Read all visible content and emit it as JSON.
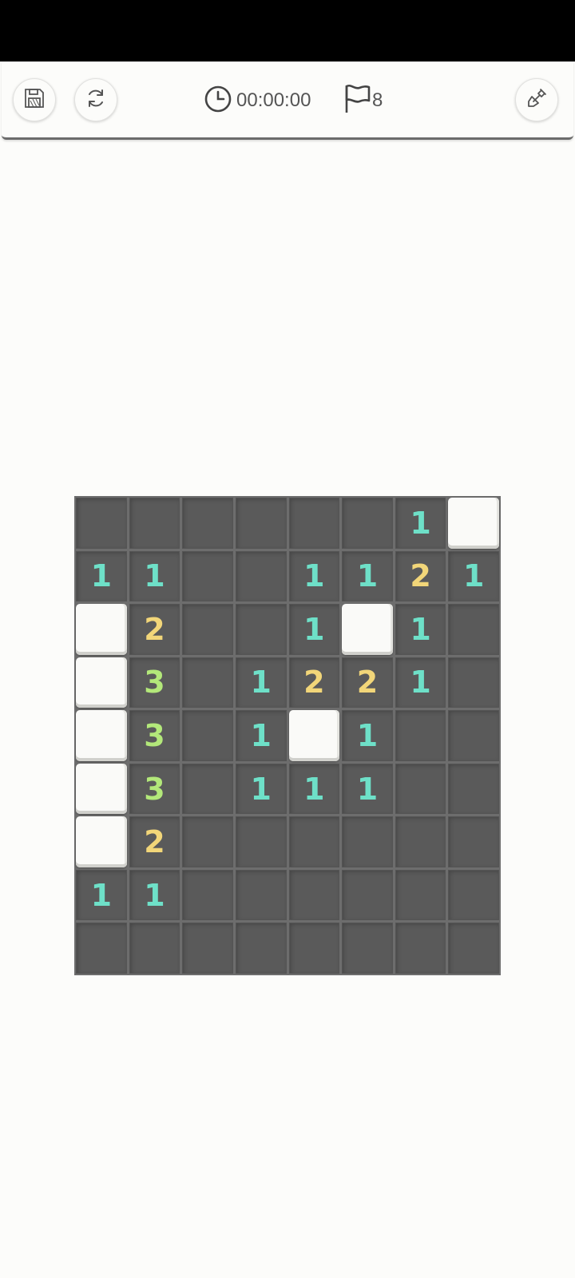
{
  "toolbar": {
    "timer": "00:00:00",
    "flags_remaining": "8",
    "icons": {
      "save": "floppy-disk-icon",
      "restart": "refresh-icon",
      "timer": "clock-icon",
      "flags": "flag-icon",
      "tool": "shovel-icon"
    }
  },
  "board": {
    "cols": 8,
    "rows": 9,
    "legend": {
      "C": "covered tile",
      ".": "revealed empty tile",
      "digits": "revealed tile with adjacent mine count"
    },
    "grid": [
      [
        ".",
        ".",
        ".",
        ".",
        ".",
        ".",
        "1",
        "C"
      ],
      [
        "1",
        "1",
        ".",
        ".",
        "1",
        "1",
        "2",
        "1"
      ],
      [
        "C",
        "2",
        ".",
        ".",
        "1",
        "C",
        "1",
        "."
      ],
      [
        "C",
        "3",
        ".",
        "1",
        "2",
        "2",
        "1",
        "."
      ],
      [
        "C",
        "3",
        ".",
        "1",
        "C",
        "1",
        ".",
        "."
      ],
      [
        "C",
        "3",
        ".",
        "1",
        "1",
        "1",
        ".",
        "."
      ],
      [
        "C",
        "2",
        ".",
        ".",
        ".",
        ".",
        ".",
        "."
      ],
      [
        "1",
        "1",
        ".",
        ".",
        ".",
        ".",
        ".",
        "."
      ],
      [
        ".",
        ".",
        ".",
        ".",
        ".",
        ".",
        ".",
        "."
      ]
    ],
    "colors": {
      "board_bg": "#6d6d6d",
      "revealed_cell": "#5a5a5a",
      "covered_cell": "#fafaf8",
      "number_1": "#6ee0c8",
      "number_2": "#f2d679",
      "number_3": "#b3e87a"
    }
  }
}
